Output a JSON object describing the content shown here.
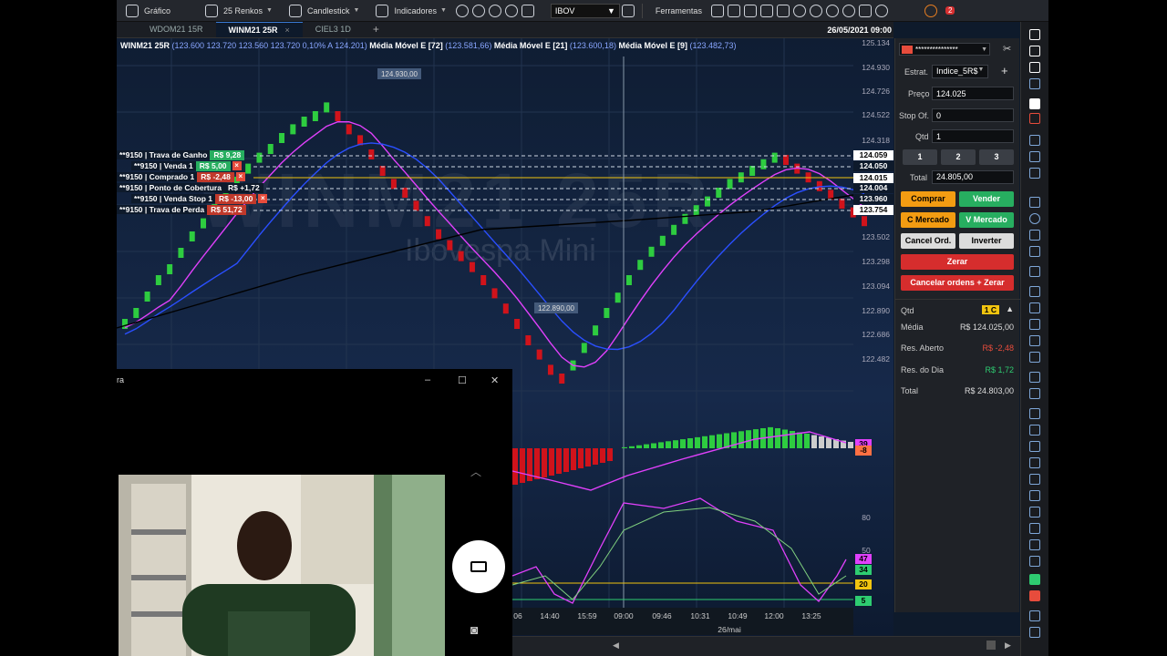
{
  "toolbar": {
    "grafico": "Gráfico",
    "renko": "25 Renkos",
    "candlestick": "Candlestick",
    "indicadores": "Indicadores",
    "symbol": "IBOV",
    "ferramentas": "Ferramentas",
    "notifications": "2"
  },
  "tabs": [
    {
      "label": "WDOM21 15R"
    },
    {
      "label": "WINM21 25R",
      "active": true
    },
    {
      "label": "CIEL3 1D"
    }
  ],
  "datetime": "26/05/2021 09:00",
  "legend": {
    "symbol": "WINM21 25R",
    "ohlc": "(123.600  123.720  123.560  123.720  0,10%  A 124.201)",
    "ma72": "Média Móvel E [72]",
    "ma72_val": "(123.581,66)",
    "ma21": "Média Móvel E [21]",
    "ma21_val": "(123.600,18)",
    "ma9": "Média Móvel E [9]",
    "ma9_val": "(123.482,73)"
  },
  "watermark": "WINM21 25R",
  "watermark_sub": "Ibovespa Mini",
  "chart_labels": {
    "high": "124.930,00",
    "low": "122.890,00"
  },
  "price_axis": [
    "125.134",
    "124.930",
    "124.726",
    "124.522",
    "124.318",
    "123.502",
    "123.298",
    "123.094",
    "122.890",
    "122.686",
    "122.482"
  ],
  "price_tags": [
    {
      "text": "124.059",
      "bg": "#ffffff",
      "fg": "#000000"
    },
    {
      "text": "124.050",
      "bg": "#0e1a2b",
      "fg": "#ffffff"
    },
    {
      "text": "124.015",
      "bg": "#ffffff",
      "fg": "#000000"
    },
    {
      "text": "124.004",
      "bg": "#0e1a2b",
      "fg": "#ffffff"
    },
    {
      "text": "123.960",
      "bg": "#0e1a2b",
      "fg": "#ffffff"
    },
    {
      "text": "123.754",
      "bg": "#ffffff",
      "fg": "#000000"
    }
  ],
  "orders": [
    {
      "label": "**9150 | Trava de Ganho",
      "value": "R$ 9,28",
      "bg": "#27ae60"
    },
    {
      "label": "**9150 | Venda 1",
      "value": "R$ 5,00",
      "bg": "#27ae60"
    },
    {
      "label": "**9150 | Comprado 1",
      "value": "R$ -2,48",
      "bg": "#c0392b"
    },
    {
      "label": "**9150 | Ponto de Cobertura",
      "value": "R$ +1,72",
      "bg": "#0e1a2b"
    },
    {
      "label": "**9150 | Venda Stop 1",
      "value": "R$ -13,00",
      "bg": "#c0392b"
    },
    {
      "label": "**9150 | Trava de Perda",
      "value": "R$ 51,72",
      "bg": "#c0392b"
    }
  ],
  "osc_axis": [
    "80",
    "50",
    "20"
  ],
  "osc_tags": [
    {
      "text": "39",
      "bg": "#e040fb"
    },
    {
      "text": "-8",
      "bg": "#ff7043"
    },
    {
      "text": "47",
      "bg": "#e040fb"
    },
    {
      "text": "34",
      "bg": "#2ecc71"
    },
    {
      "text": "20",
      "bg": "#f1c40f"
    },
    {
      "text": "5",
      "bg": "#2ecc71"
    }
  ],
  "time_axis": [
    "06",
    "14:40",
    "15:59",
    "09:00",
    "09:46",
    "10:31",
    "10:49",
    "12:00",
    "13:25"
  ],
  "date_axis": "26/mai",
  "panel": {
    "account": "***************",
    "estrat_label": "Estrat.",
    "estrat_value": "Indice_5R$",
    "preco_label": "Preço",
    "preco_value": "124.025",
    "stop_label": "Stop Of.",
    "stop_value": "0",
    "qtd_label": "Qtd",
    "qtd_value": "1",
    "qty_btns": [
      "1",
      "2",
      "3"
    ],
    "total_label": "Total",
    "total_value": "24.805,00",
    "comprar": "Comprar",
    "vender": "Vender",
    "c_mercado": "C Mercado",
    "v_mercado": "V Mercado",
    "cancel_ord": "Cancel Ord.",
    "inverter": "Inverter",
    "zerar": "Zerar",
    "cancelar_zerar": "Cancelar ordens + Zerar",
    "pos_qtd_label": "Qtd",
    "pos_qtd_value": "1 C",
    "media_label": "Média",
    "media_value": "R$ 124.025,00",
    "res_aberto_label": "Res. Aberto",
    "res_aberto_value": "R$ -2,48",
    "res_dia_label": "Res. do Dia",
    "res_dia_value": "R$ 1,72",
    "total2_label": "Total",
    "total2_value": "R$ 24.803,00"
  },
  "cam": {
    "title": "ra",
    "minimize": "–",
    "maximize": "☐",
    "close": "✕"
  }
}
